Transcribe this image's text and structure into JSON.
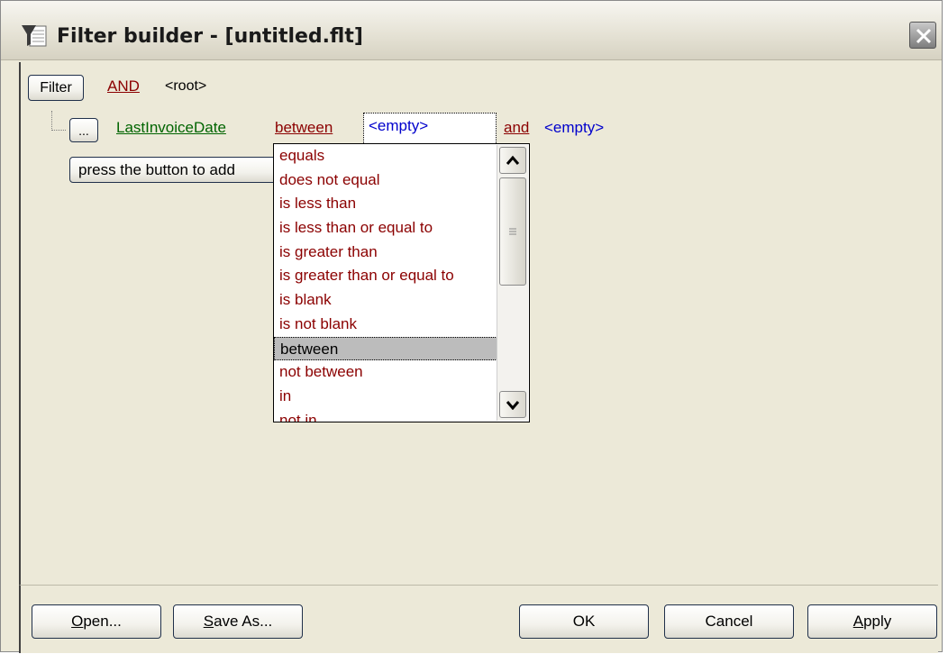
{
  "window": {
    "title": "Filter builder - [untitled.flt]",
    "icon": "filter-funnel-icon",
    "close_icon": "close-icon"
  },
  "filter": {
    "filter_button_label": "Filter",
    "root_operator": "AND",
    "root_label": "<root>",
    "condition": {
      "ellipsis_label": "...",
      "field": "LastInvoiceDate",
      "operator": "between",
      "value1": "<empty>",
      "joiner": "and",
      "value2": "<empty>"
    },
    "add_condition_label": "press the button to add"
  },
  "operator_dropdown": {
    "options": [
      "equals",
      "does not equal",
      "is less than",
      "is less than or equal to",
      "is greater than",
      "is greater than or equal to",
      "is blank",
      "is not blank",
      "between",
      "not between",
      "in",
      "not in"
    ],
    "selected": "between"
  },
  "buttons": {
    "open": {
      "mnemonic": "O",
      "rest": "pen..."
    },
    "save_as": {
      "mnemonic": "S",
      "rest": "ave As..."
    },
    "ok": "OK",
    "cancel": "Cancel",
    "apply": {
      "mnemonic": "A",
      "rest": "pply"
    }
  },
  "colors": {
    "field": "#006400",
    "operator": "#8b0000",
    "value": "#0000cc",
    "window_bg": "#ece9d8"
  }
}
